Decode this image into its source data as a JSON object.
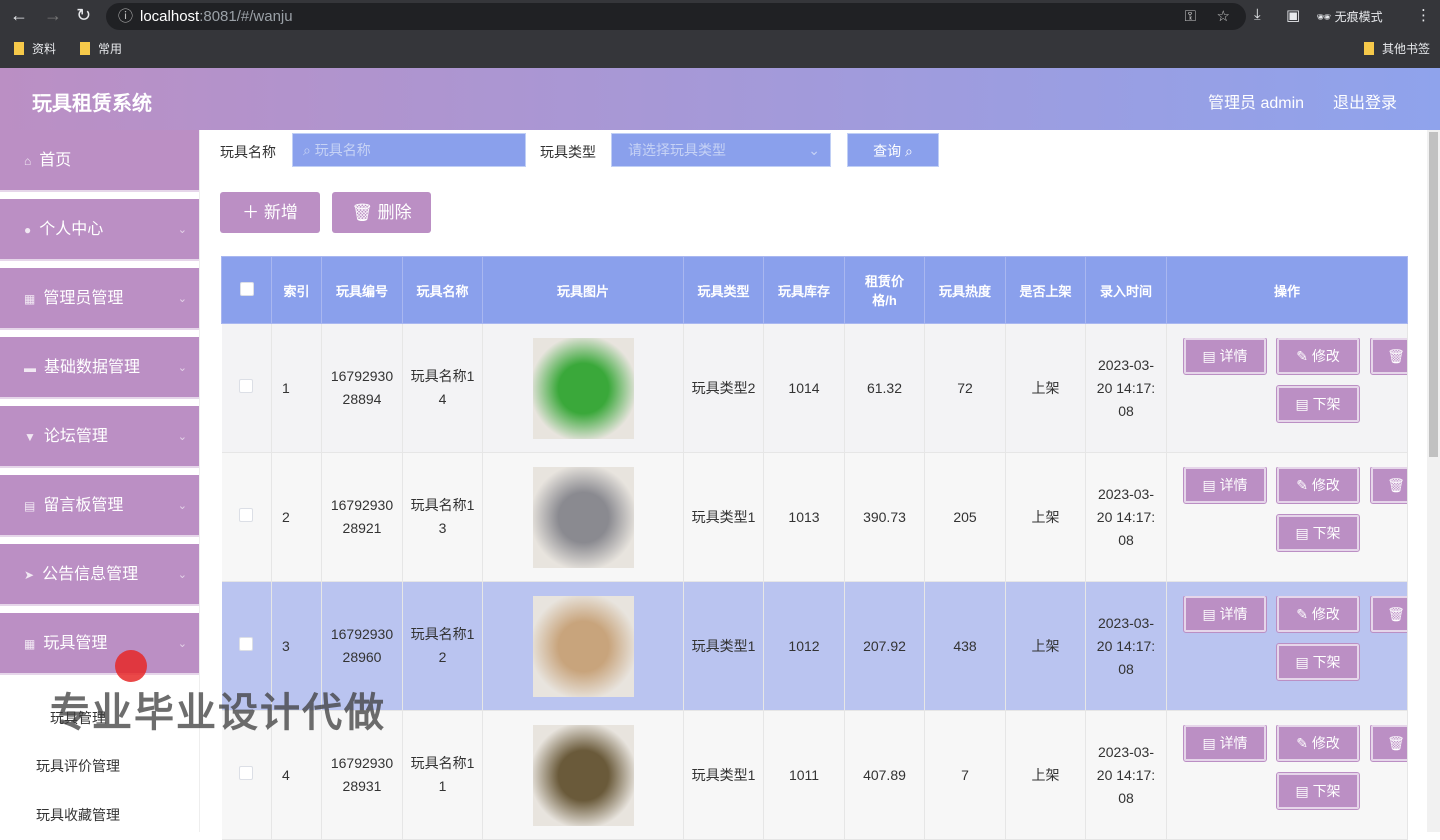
{
  "browser": {
    "url_host": "localhost",
    "url_rest": ":8081/#/wanju",
    "bookmarks": [
      "资料",
      "常用"
    ],
    "other_bookmarks": "其他书签",
    "incognito": "无痕模式"
  },
  "header": {
    "title": "玩具租赁系统",
    "user": "管理员 admin",
    "logout": "退出登录"
  },
  "sidebar": {
    "items": [
      {
        "label": "首页",
        "icon": "home-icon"
      },
      {
        "label": "个人中心",
        "icon": "user-icon"
      },
      {
        "label": "管理员管理",
        "icon": "grid-icon"
      },
      {
        "label": "基础数据管理",
        "icon": "chat-icon"
      },
      {
        "label": "论坛管理",
        "icon": "forum-icon"
      },
      {
        "label": "留言板管理",
        "icon": "clipboard-icon"
      },
      {
        "label": "公告信息管理",
        "icon": "send-icon"
      },
      {
        "label": "玩具管理",
        "icon": "grid-icon"
      }
    ],
    "subitems": [
      "玩具管理",
      "玩具评价管理",
      "玩具收藏管理"
    ]
  },
  "search": {
    "name_label": "玩具名称",
    "name_placeholder": "玩具名称",
    "type_label": "玩具类型",
    "type_placeholder": "请选择玩具类型",
    "query": "查询"
  },
  "actions": {
    "add": "新增",
    "delete": "删除"
  },
  "table": {
    "headers": [
      "索引",
      "玩具编号",
      "玩具名称",
      "玩具图片",
      "玩具类型",
      "玩具库存",
      "租赁价格/h",
      "玩具热度",
      "是否上架",
      "录入时间",
      "操作"
    ],
    "rows": [
      {
        "index": "1",
        "code": "1679293028894",
        "name": "玩具名称14",
        "type": "玩具类型2",
        "stock": "1014",
        "price": "61.32",
        "heat": "72",
        "status": "上架",
        "time": "2023-03-20 14:17:08",
        "img_color": "#3aa83a"
      },
      {
        "index": "2",
        "code": "1679293028921",
        "name": "玩具名称13",
        "type": "玩具类型1",
        "stock": "1013",
        "price": "390.73",
        "heat": "205",
        "status": "上架",
        "time": "2023-03-20 14:17:08",
        "img_color": "#8a8a90"
      },
      {
        "index": "3",
        "code": "1679293028960",
        "name": "玩具名称12",
        "type": "玩具类型1",
        "stock": "1012",
        "price": "207.92",
        "heat": "438",
        "status": "上架",
        "time": "2023-03-20 14:17:08",
        "img_color": "#c8a47c"
      },
      {
        "index": "4",
        "code": "1679293028931",
        "name": "玩具名称11",
        "type": "玩具类型1",
        "stock": "1011",
        "price": "407.89",
        "heat": "7",
        "status": "上架",
        "time": "2023-03-20 14:17:08",
        "img_color": "#6a5a3a"
      }
    ],
    "ops": {
      "detail": "详情",
      "edit": "修改",
      "delete": "删除",
      "offshelf": "下架"
    }
  },
  "watermark": "专业毕业设计代做",
  "colors": {
    "accent": "#bb8fc4",
    "table_header": "#8aa0ec",
    "highlight_row": "#bac4f0"
  }
}
